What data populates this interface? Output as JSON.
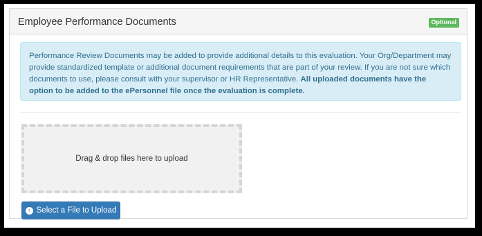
{
  "panel": {
    "title": "Employee Performance Documents",
    "badge": "Optional"
  },
  "info": {
    "text": "Performance Review Documents may be added to provide additional details to this evaluation. Your Org/Department may provide standardized template or additional document requirements that are part of your review. If you are not sure which documents to use, please consult with your supervisor or HR Representative.",
    "bold_text": "All uploaded documents have the option to be added to the ePersonnel file once the evaluation is complete."
  },
  "dropzone": {
    "label": "Drag & drop files here to upload"
  },
  "upload_button": {
    "label": "Select a File to Upload",
    "icon": "arrow-circle-up-icon"
  },
  "colors": {
    "primary": "#337ab7",
    "badge": "#5cb85c",
    "info_bg": "#d9edf7",
    "info_text": "#31708f"
  }
}
